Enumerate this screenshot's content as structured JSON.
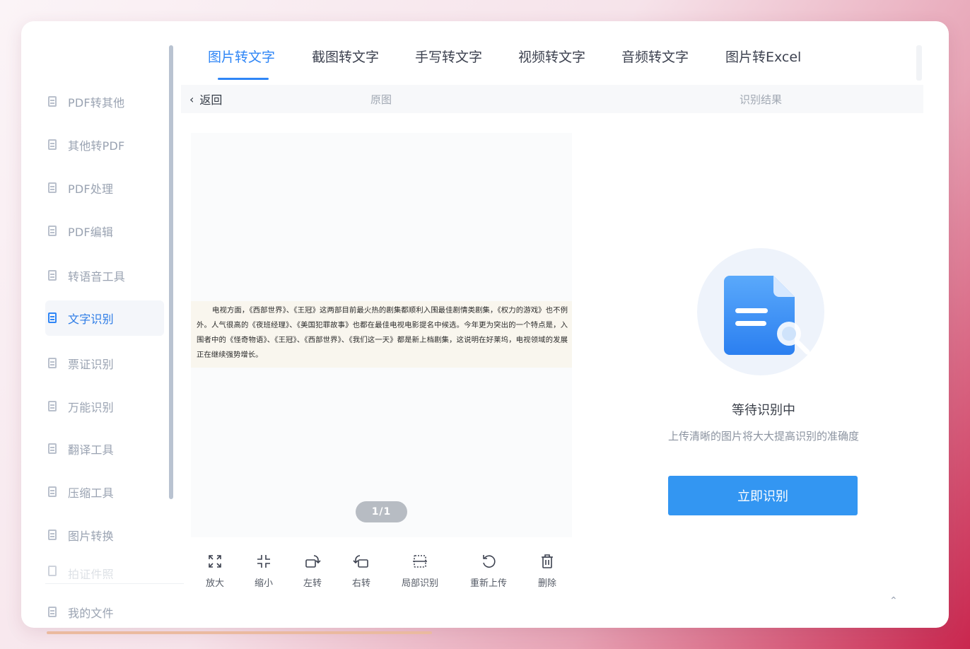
{
  "sidebar": {
    "items": [
      {
        "label": "PDF转其他",
        "icon": "pdf-convert-icon"
      },
      {
        "label": "其他转PDF",
        "icon": "to-pdf-icon"
      },
      {
        "label": "PDF处理",
        "icon": "pdf-process-icon"
      },
      {
        "label": "PDF编辑",
        "icon": "pdf-edit-icon"
      },
      {
        "label": "转语音工具",
        "icon": "speech-icon"
      },
      {
        "label": "文字识别",
        "icon": "ocr-icon"
      },
      {
        "label": "票证识别",
        "icon": "ticket-icon"
      },
      {
        "label": "万能识别",
        "icon": "universal-icon"
      },
      {
        "label": "翻译工具",
        "icon": "translate-icon"
      },
      {
        "label": "压缩工具",
        "icon": "compress-icon"
      },
      {
        "label": "图片转换",
        "icon": "image-convert-icon"
      },
      {
        "label": "拍证件照",
        "icon": "id-photo-icon"
      },
      {
        "label": "我的文件",
        "icon": "my-files-icon"
      }
    ],
    "active": "文字识别"
  },
  "tabs": [
    {
      "label": "图片转文字"
    },
    {
      "label": "截图转文字"
    },
    {
      "label": "手写转文字"
    },
    {
      "label": "视频转文字"
    },
    {
      "label": "音频转文字"
    },
    {
      "label": "图片转Excel"
    }
  ],
  "subheader": {
    "back_label": "返回",
    "original_label": "原图",
    "result_label": "识别结果"
  },
  "preview": {
    "image_text": "电视方面，《西部世界》、《王冠》这两部目前最火热的剧集都顺利入围最佳剧情类剧集，《权力的游戏》也不例外。人气很高的《夜班经理》、《美国犯罪故事》也都在最佳电视电影提名中候选。今年更为突出的一个特点是，入围者中的《怪奇物语》、《王冠》、《西部世界》、《我们这一天》都是新上档剧集，这说明在好莱坞，电视领域的发展正在继续强势增长。",
    "pager": "1/1"
  },
  "toolbar": {
    "zoom_in": "放大",
    "zoom_out": "缩小",
    "rotate_left": "左转",
    "rotate_right": "右转",
    "partial": "局部识别",
    "reupload": "重新上传",
    "delete": "删除"
  },
  "result": {
    "status": "等待识别中",
    "hint": "上传清晰的图片将大大提高识别的准确度",
    "button": "立即识别"
  },
  "colors": {
    "accent": "#2f86f6",
    "button": "#3396f2",
    "sidebar_text": "#9aa3b2"
  }
}
